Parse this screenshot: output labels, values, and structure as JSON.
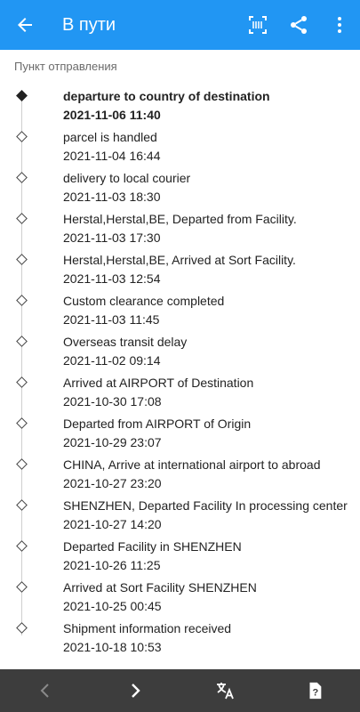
{
  "appbar": {
    "title": "В пути",
    "icons": [
      "arrow-back-icon",
      "barcode-icon",
      "share-icon",
      "more-vert-icon"
    ]
  },
  "section_label": "Пункт отправления",
  "events": [
    {
      "description": "departure to country of destination",
      "time": "2021-11-06 11:40",
      "current": true
    },
    {
      "description": "parcel is handled",
      "time": "2021-11-04 16:44"
    },
    {
      "description": "delivery to local courier",
      "time": "2021-11-03 18:30"
    },
    {
      "description": "Herstal,Herstal,BE, Departed from Facility.",
      "time": "2021-11-03 17:30"
    },
    {
      "description": "Herstal,Herstal,BE, Arrived at Sort Facility.",
      "time": "2021-11-03 12:54"
    },
    {
      "description": "Custom clearance completed",
      "time": "2021-11-03 11:45"
    },
    {
      "description": "Overseas transit delay",
      "time": "2021-11-02 09:14"
    },
    {
      "description": "Arrived at AIRPORT of Destination",
      "time": "2021-10-30 17:08"
    },
    {
      "description": "Departed from AIRPORT of Origin",
      "time": "2021-10-29 23:07"
    },
    {
      "description": "CHINA, Arrive at international airport to abroad",
      "time": "2021-10-27 23:20"
    },
    {
      "description": "SHENZHEN, Departed Facility In processing center",
      "time": "2021-10-27 14:20"
    },
    {
      "description": "Departed Facility in SHENZHEN",
      "time": "2021-10-26 11:25"
    },
    {
      "description": "Arrived at Sort Facility SHENZHEN",
      "time": "2021-10-25 00:45"
    },
    {
      "description": "Shipment information received",
      "time": "2021-10-18 10:53"
    }
  ],
  "bottombar": {
    "icons": [
      "chevron-left-icon",
      "chevron-right-icon",
      "translate-icon",
      "help-icon"
    ]
  },
  "colors": {
    "primary": "#2196F3",
    "bottom_bar": "#3d3d3d"
  }
}
